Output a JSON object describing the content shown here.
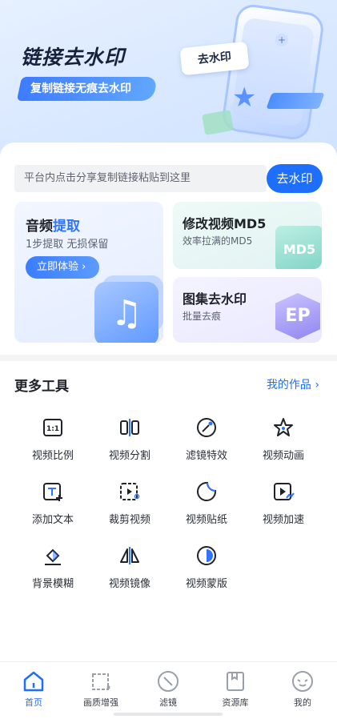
{
  "hero": {
    "title": "链接去水印",
    "subtitle": "复制链接无痕去水印",
    "badge": "去水印"
  },
  "search": {
    "placeholder": "平台内点击分享复制链接粘贴到这里",
    "button": "去水印"
  },
  "cards": {
    "audio": {
      "title_prefix": "音频",
      "title_highlight": "提取",
      "subtitle": "1步提取 无损保留",
      "button": "立即体验"
    },
    "md5": {
      "title": "修改视频MD5",
      "subtitle": "效率拉满的MD5",
      "mark": "MD5"
    },
    "gallery": {
      "title": "图集去水印",
      "subtitle": "批量去痕",
      "mark": "EP"
    }
  },
  "tools": {
    "heading": "更多工具",
    "link": "我的作品",
    "items": [
      {
        "label": "视频比例",
        "icon": "aspect-ratio-icon"
      },
      {
        "label": "视频分割",
        "icon": "split-icon"
      },
      {
        "label": "滤镜特效",
        "icon": "filter-effect-icon"
      },
      {
        "label": "视频动画",
        "icon": "star-animation-icon"
      },
      {
        "label": "添加文本",
        "icon": "add-text-icon"
      },
      {
        "label": "裁剪视频",
        "icon": "crop-video-icon"
      },
      {
        "label": "视频贴纸",
        "icon": "sticker-icon"
      },
      {
        "label": "视频加速",
        "icon": "speed-icon"
      },
      {
        "label": "背景模糊",
        "icon": "blur-background-icon"
      },
      {
        "label": "视频镜像",
        "icon": "mirror-icon"
      },
      {
        "label": "视频蒙版",
        "icon": "mask-icon"
      }
    ]
  },
  "tabbar": {
    "items": [
      {
        "label": "首页",
        "icon": "home-icon",
        "active": true
      },
      {
        "label": "画质增强",
        "icon": "enhance-icon",
        "active": false
      },
      {
        "label": "滤镜",
        "icon": "filter-icon",
        "active": false
      },
      {
        "label": "资源库",
        "icon": "library-icon",
        "active": false
      },
      {
        "label": "我的",
        "icon": "profile-icon",
        "active": false
      }
    ]
  },
  "colors": {
    "accent": "#1f6fff",
    "text": "#1f2329",
    "subtext": "#5c6370"
  }
}
